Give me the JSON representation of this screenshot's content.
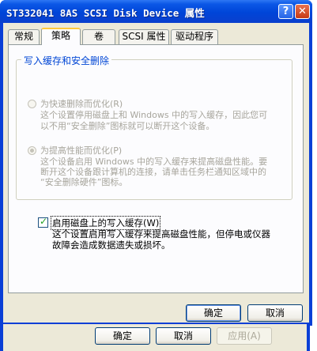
{
  "window": {
    "title": "ST332041 8AS SCSI Disk Device 属性",
    "help_button": "?",
    "close_button": "✕"
  },
  "tabs": [
    {
      "label": "常规"
    },
    {
      "label": "策略"
    },
    {
      "label": "卷"
    },
    {
      "label": "SCSI 属性"
    },
    {
      "label": "驱动程序"
    }
  ],
  "group": {
    "title": "写入缓存和安全删除",
    "option_quick": {
      "label": "为快速删除而优化(R)",
      "desc_line1": "这个设置停用磁盘上和 Windows 中的写入缓存，因此您可",
      "desc_line2": "以不用“安全删除”图标就可以断开这个设备。"
    },
    "option_perf": {
      "label": "为提高性能而优化(P)",
      "desc_line1": "这个设备启用 Windows 中的写入缓存来提高磁盘性能。要",
      "desc_line2": "断开这个设备跟计算机的连接，请单击任务栏通知区域中的",
      "desc_line3": "“安全删除硬件”图标。"
    }
  },
  "write_cache": {
    "label": "启用磁盘上的写入缓存(W)",
    "checked": true,
    "desc_line1": "这个设置启用写入缓存来提高磁盘性能，但停电或仪器",
    "desc_line2": "故障会造成数据遗失或损坏。"
  },
  "dialog_buttons": {
    "ok": "确定",
    "cancel": "取消"
  },
  "back_window_buttons": {
    "ok": "确定",
    "cancel": "取消",
    "apply": "应用(A)"
  }
}
